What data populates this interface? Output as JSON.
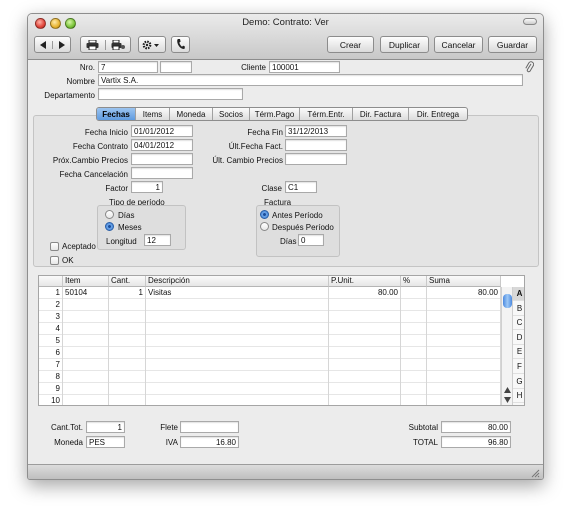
{
  "window": {
    "title": "Demo: Contrato: Ver"
  },
  "toolbar": {
    "back_icon": "left-arrow-icon",
    "forward_icon": "right-arrow-icon",
    "print_icon": "printer-icon",
    "print_options_icon": "printer-settings-icon",
    "action_icon": "gear-dropdown-icon",
    "call_icon": "phone-icon",
    "buttons": {
      "crear": "Crear",
      "duplicar": "Duplicar",
      "cancelar": "Cancelar",
      "guardar": "Guardar"
    }
  },
  "header": {
    "nro_label": "Nro.",
    "nro_value": "7",
    "nro_value2": "",
    "nro_value3": "",
    "cliente_label": "Cliente",
    "cliente_value": "100001",
    "nombre_label": "Nombre",
    "nombre_value": "Vartix S.A.",
    "departamento_label": "Departamento",
    "departamento_value": "",
    "attach_icon": "paperclip-icon"
  },
  "tabs": [
    "Fechas",
    "Items",
    "Moneda",
    "Socios",
    "Térm.Pago",
    "Térm.Entr.",
    "Dir. Factura",
    "Dir. Entrega"
  ],
  "active_tab": "Fechas",
  "fechas": {
    "fecha_inicio_label": "Fecha Inicio",
    "fecha_inicio": "01/01/2012",
    "fecha_fin_label": "Fecha Fin",
    "fecha_fin": "31/12/2013",
    "fecha_contrato_label": "Fecha Contrato",
    "fecha_contrato": "04/01/2012",
    "ult_fecha_fact_label": "Últ.Fecha Fact.",
    "ult_fecha_fact": "",
    "prox_cambio_label": "Próx.Cambio Precios",
    "prox_cambio": "",
    "ult_cambio_label": "Últ. Cambio Precios",
    "ult_cambio": "",
    "fecha_cancelacion_label": "Fecha Cancelación",
    "fecha_cancelacion": "",
    "factor_label": "Factor",
    "factor": "1",
    "clase_label": "Clase",
    "clase": "C1",
    "tipo_periodo_label": "Tipo de período",
    "dias_option": "Días",
    "meses_option": "Meses",
    "longitud_label": "Longitud",
    "longitud": "12",
    "factura_label": "Factura",
    "antes_option": "Antes Período",
    "despues_option": "Después Período",
    "dias_label": "Días",
    "dias": "0",
    "aceptado_label": "Aceptado",
    "ok_label": "OK"
  },
  "grid": {
    "columns": [
      "Item",
      "Cant.",
      "Descripción",
      "P.Unit.",
      "%",
      "Suma"
    ],
    "rows": [
      {
        "n": "1",
        "item": "50104",
        "cant": "1",
        "desc": "Visitas",
        "punit": "80.00",
        "pct": "",
        "suma": "80.00"
      },
      {
        "n": "2",
        "item": "",
        "cant": "",
        "desc": "",
        "punit": "",
        "pct": "",
        "suma": ""
      },
      {
        "n": "3",
        "item": "",
        "cant": "",
        "desc": "",
        "punit": "",
        "pct": "",
        "suma": ""
      },
      {
        "n": "4",
        "item": "",
        "cant": "",
        "desc": "",
        "punit": "",
        "pct": "",
        "suma": ""
      },
      {
        "n": "5",
        "item": "",
        "cant": "",
        "desc": "",
        "punit": "",
        "pct": "",
        "suma": ""
      },
      {
        "n": "6",
        "item": "",
        "cant": "",
        "desc": "",
        "punit": "",
        "pct": "",
        "suma": ""
      },
      {
        "n": "7",
        "item": "",
        "cant": "",
        "desc": "",
        "punit": "",
        "pct": "",
        "suma": ""
      },
      {
        "n": "8",
        "item": "",
        "cant": "",
        "desc": "",
        "punit": "",
        "pct": "",
        "suma": ""
      },
      {
        "n": "9",
        "item": "",
        "cant": "",
        "desc": "",
        "punit": "",
        "pct": "",
        "suma": ""
      },
      {
        "n": "10",
        "item": "",
        "cant": "",
        "desc": "",
        "punit": "",
        "pct": "",
        "suma": ""
      }
    ],
    "letters": [
      "A",
      "B",
      "C",
      "D",
      "E",
      "F",
      "G",
      "H"
    ],
    "selected_letter": "A"
  },
  "footer": {
    "cant_tot_label": "Cant.Tot.",
    "cant_tot": "1",
    "flete_label": "Flete",
    "flete": "",
    "subtotal_label": "Subtotal",
    "subtotal": "80.00",
    "moneda_label": "Moneda",
    "moneda": "PES",
    "iva_label": "IVA",
    "iva": "16.80",
    "total_label": "TOTAL",
    "total": "96.80"
  }
}
